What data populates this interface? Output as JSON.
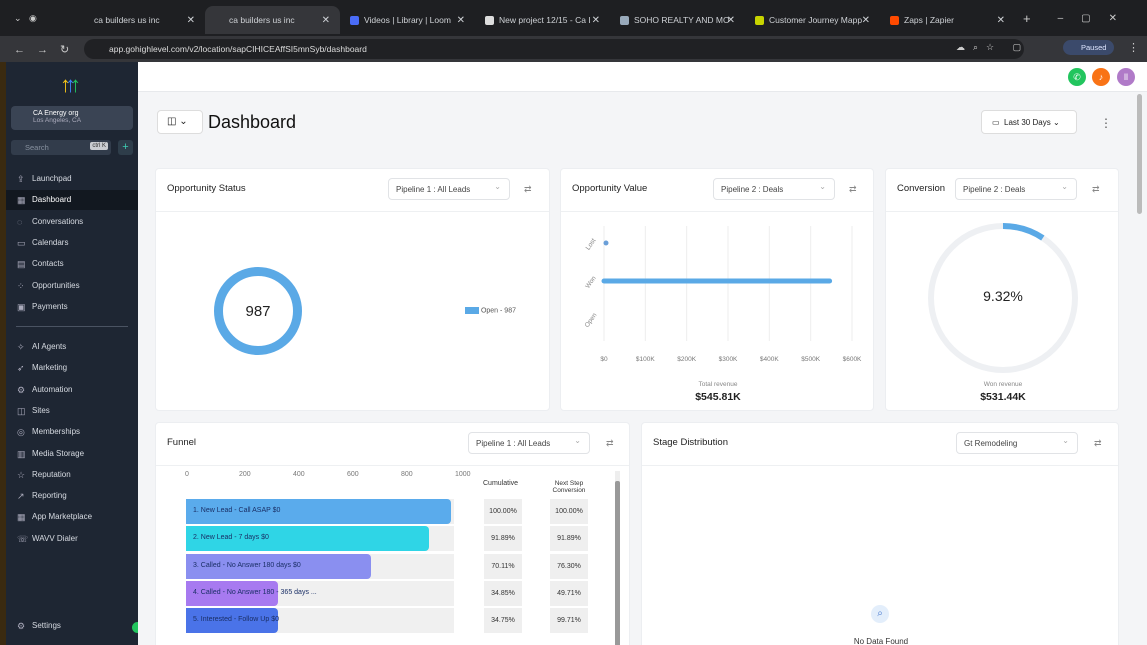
{
  "browser": {
    "tabs": [
      {
        "label": "ca builders us inc",
        "color": "#888"
      },
      {
        "label": "ca builders us inc",
        "color": "#888"
      },
      {
        "label": "Videos | Library | Loom",
        "color": "#4a6cf7"
      },
      {
        "label": "New project 12/15 - Ca I",
        "color": "#ddd"
      },
      {
        "label": "SOHO REALTY AND MO",
        "color": "#9ab"
      },
      {
        "label": "Customer Journey Mapp",
        "color": "#c8d400"
      },
      {
        "label": "Zaps | Zapier",
        "color": "#ff4a00"
      }
    ],
    "url": "app.gohighlevel.com/v2/location/sapCIHICEAffSI5mnSyb/dashboard",
    "profile": "Paused"
  },
  "sidebar": {
    "account_name": "CA Energy org",
    "account_location": "Los Angeles, CA",
    "search_placeholder": "Search",
    "search_shortcut": "ctrl K",
    "items": [
      {
        "label": "Launchpad",
        "icon": "⇪"
      },
      {
        "label": "Dashboard",
        "icon": "▦"
      },
      {
        "label": "Conversations",
        "icon": "◌"
      },
      {
        "label": "Calendars",
        "icon": "▭"
      },
      {
        "label": "Contacts",
        "icon": "▤"
      },
      {
        "label": "Opportunities",
        "icon": "⁘"
      },
      {
        "label": "Payments",
        "icon": "▣"
      }
    ],
    "items2": [
      {
        "label": "AI Agents",
        "icon": "✧"
      },
      {
        "label": "Marketing",
        "icon": "➶"
      },
      {
        "label": "Automation",
        "icon": "⚙"
      },
      {
        "label": "Sites",
        "icon": "◫"
      },
      {
        "label": "Memberships",
        "icon": "◎"
      },
      {
        "label": "Media Storage",
        "icon": "▥"
      },
      {
        "label": "Reputation",
        "icon": "☆"
      },
      {
        "label": "Reporting",
        "icon": "↗"
      },
      {
        "label": "App Marketplace",
        "icon": "▦"
      },
      {
        "label": "WAVV Dialer",
        "icon": "☏"
      }
    ],
    "settings": "Settings"
  },
  "header": {
    "title": "Dashboard",
    "date_range": "Last 30 Days"
  },
  "opportunity_status": {
    "title": "Opportunity Status",
    "pipeline": "Pipeline 1 : All Leads",
    "total": "987",
    "legend": "Open - 987",
    "color": "#5aa9e6"
  },
  "opportunity_value": {
    "title": "Opportunity Value",
    "pipeline": "Pipeline 2 : Deals",
    "total_label": "Total revenue",
    "total": "$545.81K"
  },
  "conversion": {
    "title": "Conversion",
    "pipeline": "Pipeline 2 : Deals",
    "percent": "9.32%",
    "percent_value": 9.32,
    "won_label": "Won revenue",
    "won": "$531.44K"
  },
  "funnel": {
    "title": "Funnel",
    "pipeline": "Pipeline 1 : All Leads",
    "col_cumulative": "Cumulative",
    "col_next": "Next Step Conversion",
    "axis": [
      "0",
      "200",
      "400",
      "600",
      "800",
      "1000"
    ],
    "rows": [
      {
        "label": "1. New Lead - Call ASAP   $0",
        "value": 987,
        "color": "#5aabec",
        "cumulative": "100.00%",
        "next": "100.00%"
      },
      {
        "label": "2. New Lead - 7 days   $0",
        "value": 907,
        "color": "#2fd5e6",
        "cumulative": "91.89%",
        "next": "91.89%"
      },
      {
        "label": "3. Called - No Answer   180 days   $0",
        "value": 692,
        "color": "#8a8ff0",
        "cumulative": "70.11%",
        "next": "76.30%"
      },
      {
        "label": "4. Called - No Answer   180 - 365 days ...",
        "value": 344,
        "color": "#a77af0",
        "cumulative": "34.85%",
        "next": "49.71%"
      },
      {
        "label": "5. Interested - Follow Up   $0",
        "value": 343,
        "color": "#4a73e8",
        "cumulative": "34.75%",
        "next": "99.71%"
      }
    ]
  },
  "stage_distribution": {
    "title": "Stage Distribution",
    "pipeline": "Gt Remodeling",
    "empty": "No Data Found"
  },
  "chart_data": {
    "type": "bar",
    "title": "Opportunity Value",
    "categories": [
      "Lost",
      "Won",
      "Open"
    ],
    "values": [
      0,
      545810,
      0
    ],
    "xlabel": "Total revenue",
    "xticks": [
      "$0",
      "$100K",
      "$200K",
      "$300K",
      "$400K",
      "$500K",
      "$600K"
    ],
    "xlim": [
      0,
      600000
    ]
  }
}
